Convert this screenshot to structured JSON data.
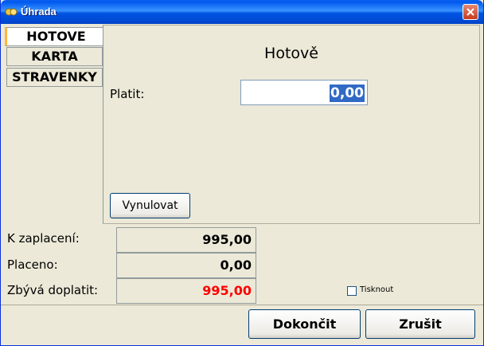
{
  "window": {
    "title": "Úhrada"
  },
  "tabs": [
    {
      "label": "HOTOVE",
      "active": true
    },
    {
      "label": "KARTA",
      "active": false
    },
    {
      "label": "STRAVENKY",
      "active": false
    }
  ],
  "panel": {
    "title": "Hotově",
    "pay_label": "Platit:",
    "pay_value": "0,00",
    "reset_button": "Vynulovat"
  },
  "summary": {
    "to_pay_label": "K zaplacení:",
    "to_pay_value": "995,00",
    "paid_label": "Placeno:",
    "paid_value": "0,00",
    "remaining_label": "Zbývá doplatit:",
    "remaining_value": "995,00",
    "remaining_color": "#ff0000"
  },
  "print_checkbox": {
    "label": "Tisknout",
    "checked": false
  },
  "footer": {
    "finish_button": "Dokončit",
    "cancel_button": "Zrušit"
  }
}
